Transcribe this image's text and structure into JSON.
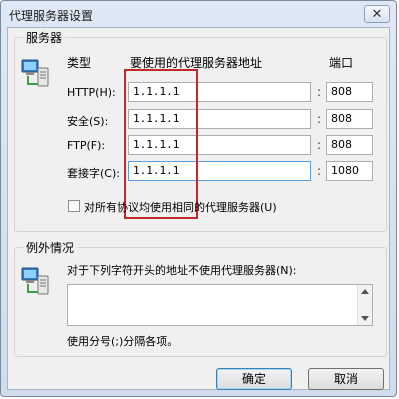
{
  "window": {
    "title": "代理服务器设置",
    "close_glyph": "✕"
  },
  "servers": {
    "group_label": "服务器",
    "col_type": "类型",
    "col_address": "要使用的代理服务器地址",
    "col_port": "端口",
    "rows": [
      {
        "label": "HTTP(H):",
        "address": "1.1.1.1",
        "port": "808"
      },
      {
        "label": "安全(S):",
        "address": "1.1.1.1",
        "port": "808"
      },
      {
        "label": "FTP(F):",
        "address": "1.1.1.1",
        "port": "808"
      },
      {
        "label": "套接字(C):",
        "address": "1.1.1.1",
        "port": "1080"
      }
    ],
    "colon": ":",
    "same_proxy_label": "对所有协议均使用相同的代理服务器(U)",
    "same_proxy_checked": false
  },
  "exceptions": {
    "group_label": "例外情况",
    "instruction": "对于下列字符开头的地址不使用代理服务器(N):",
    "textarea_value": "",
    "hint": "使用分号(;)分隔各项。"
  },
  "buttons": {
    "ok": "确定",
    "cancel": "取消"
  },
  "icons": {
    "servers": "network-computer-icon",
    "exceptions": "network-computer-icon"
  },
  "colors": {
    "highlight": "#c0282e"
  }
}
